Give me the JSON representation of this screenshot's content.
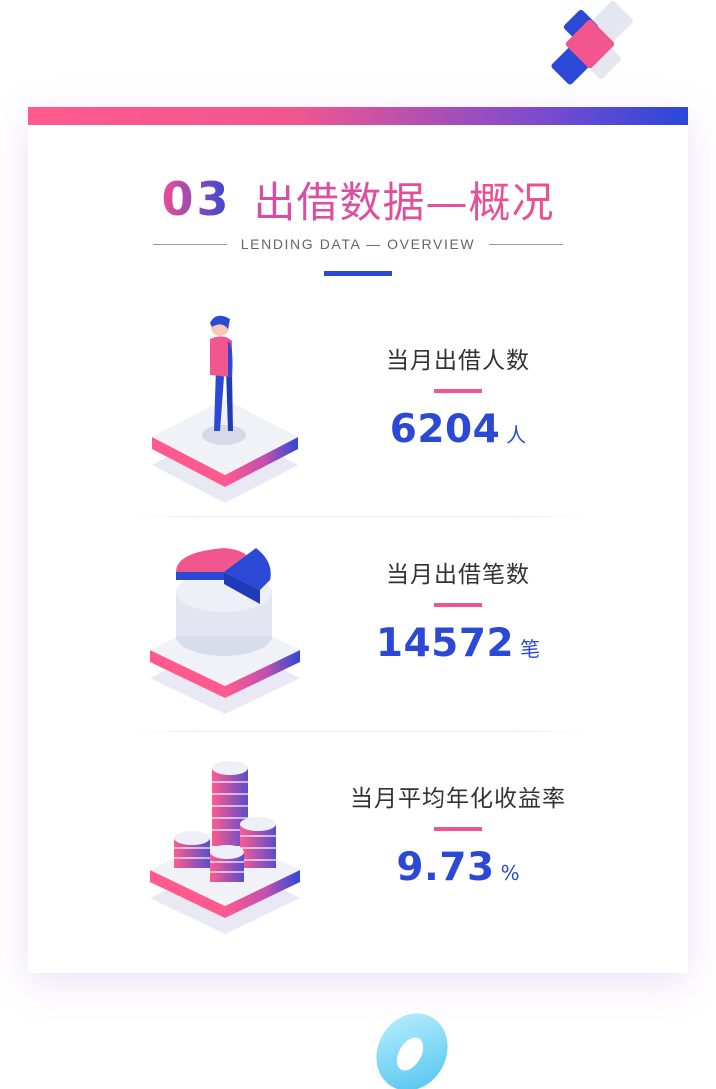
{
  "header": {
    "number": "03",
    "title": "出借数据—概况",
    "subtitle": "LENDING DATA — OVERVIEW"
  },
  "colors": {
    "pink": "#f2568f",
    "blue": "#2c49d6",
    "purple": "#7a4bd0"
  },
  "stats": [
    {
      "label": "当月出借人数",
      "value": "6204",
      "unit": "人",
      "icon": "person-on-platform-icon"
    },
    {
      "label": "当月出借笔数",
      "value": "14572",
      "unit": "笔",
      "icon": "pie-chart-on-platform-icon"
    },
    {
      "label": "当月平均年化收益率",
      "value": "9.73",
      "unit": "%",
      "icon": "coin-stacks-on-platform-icon"
    }
  ]
}
